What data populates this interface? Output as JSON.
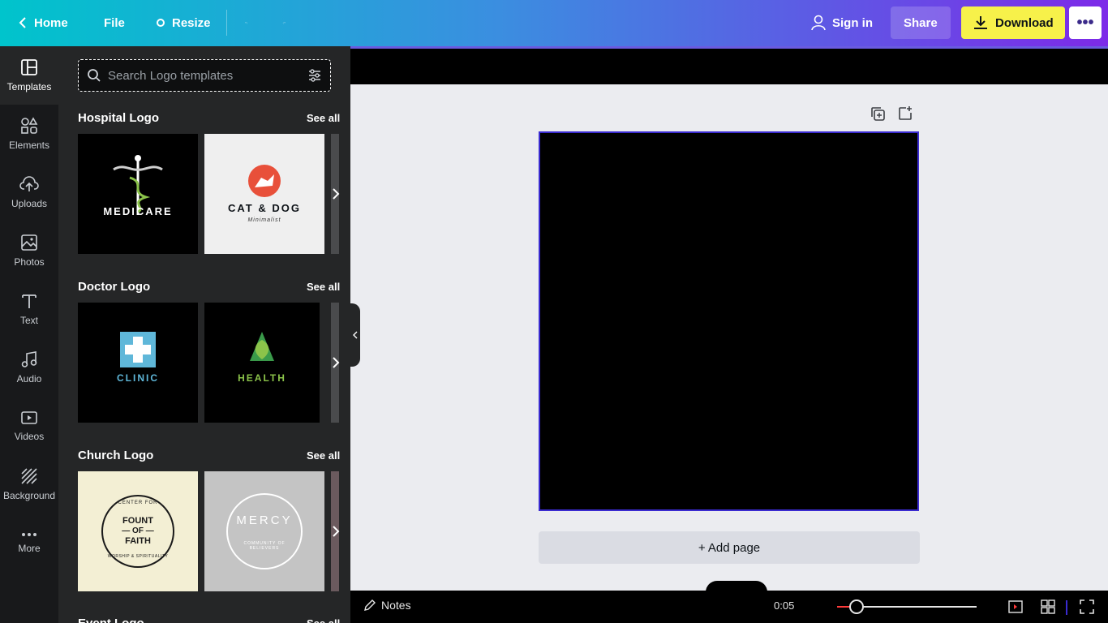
{
  "topbar": {
    "home_label": "Home",
    "file_label": "File",
    "resize_label": "Resize",
    "signin_label": "Sign in",
    "share_label": "Share",
    "download_label": "Download",
    "more_label": "•••"
  },
  "rail": {
    "items": [
      {
        "label": "Templates"
      },
      {
        "label": "Elements"
      },
      {
        "label": "Uploads"
      },
      {
        "label": "Photos"
      },
      {
        "label": "Text"
      },
      {
        "label": "Audio"
      },
      {
        "label": "Videos"
      },
      {
        "label": "Background"
      },
      {
        "label": "More"
      }
    ]
  },
  "panel": {
    "search_placeholder": "Search Logo templates",
    "see_all": "See all",
    "sections": [
      {
        "title": "Hospital Logo",
        "cards": [
          {
            "text": "MEDICARE"
          },
          {
            "title": "CAT & DOG",
            "subtitle": "Minimalist"
          }
        ]
      },
      {
        "title": "Doctor Logo",
        "cards": [
          {
            "text": "CLINIC"
          },
          {
            "text": "HEALTH"
          }
        ]
      },
      {
        "title": "Church Logo",
        "cards": [
          {
            "top": "CENTER FOR",
            "line1": "FOUNT",
            "line2": "— OF —",
            "line3": "FAITH",
            "bottom": "WORSHIP & SPIRITUALITY"
          },
          {
            "title": "MERCY",
            "subtitle": "COMMUNITY OF BELIEVERS"
          }
        ]
      },
      {
        "title": "Event Logo"
      }
    ]
  },
  "canvas": {
    "add_page_label": "+ Add page"
  },
  "bottombar": {
    "notes_label": "Notes",
    "time_label": "0:05"
  },
  "zoom": {
    "fraction": 0.14
  },
  "colors": {
    "accent": "#7d2ae8",
    "download": "#f7f14a",
    "rail": "#18191b",
    "panel": "#252627"
  }
}
